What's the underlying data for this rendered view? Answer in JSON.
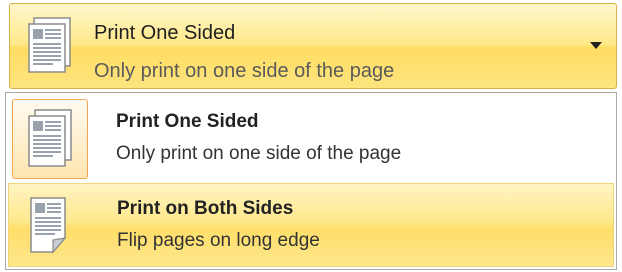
{
  "selector": {
    "title": "Print One Sided",
    "subtitle": "Only print on one side of the page",
    "icon": "one-sided-page-icon",
    "arrow_icon": "dropdown-arrow-icon"
  },
  "options": [
    {
      "title": "Print One Sided",
      "description": "Only print on one side of the page",
      "icon": "one-sided-page-icon",
      "selected": true
    },
    {
      "title": "Print on Both Sides",
      "description": "Flip pages on long edge",
      "icon": "two-sided-page-icon",
      "hovered": true
    }
  ],
  "colors": {
    "highlight_top": "#fff7cd",
    "highlight_bottom": "#ffdd62",
    "selected_border": "#f2a553",
    "dropdown_border": "#a9a9a9"
  }
}
